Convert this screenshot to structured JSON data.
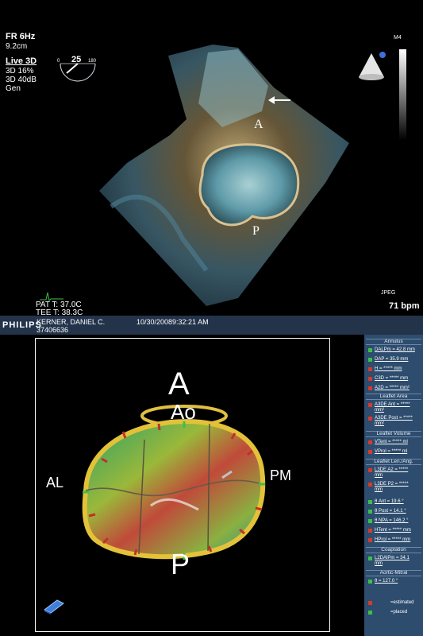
{
  "echo": {
    "frame_rate": "FR 6Hz",
    "depth": "9.2cm",
    "mode": "Live 3D",
    "param_1": "3D 16%",
    "param_2": "3D 40dB",
    "param_3": "Gen",
    "gauge_min": "0",
    "gauge_value": "25",
    "gauge_max": "180",
    "probe_label": "M4",
    "label_a": "A",
    "label_p": "P",
    "format": "JPEG",
    "heart_rate": "71 bpm",
    "pat_temp": "PAT T: 37.0C",
    "tee_temp": "TEE T: 38.3C"
  },
  "patient_bar": {
    "brand": "PHILIPS",
    "patient_name": "KERNER, DANIEL C.",
    "patient_id": "37406636",
    "datetime": "10/30/20089:32:21 AM"
  },
  "model": {
    "label_anterior": "A",
    "label_aortic": "Ao",
    "label_al": "AL",
    "label_pm": "PM",
    "label_posterior": "P"
  },
  "measurements": {
    "sections": [
      {
        "title": "Annulus",
        "rows": [
          {
            "text": "DALPm = 42.8 mm",
            "status": "green"
          },
          {
            "text": "DAP = 35.9 mm",
            "status": "green"
          },
          {
            "text": "H = ***** mm",
            "status": "red"
          },
          {
            "text": "C3D = ***** mm",
            "status": "red"
          },
          {
            "text": "A2D = ***** mm²",
            "status": "red"
          }
        ]
      },
      {
        "title": "Leaflet Area",
        "rows": [
          {
            "text": "A3DE Ant = *****",
            "text2": "mm²",
            "status": "red"
          },
          {
            "text": "A3DE Post = *****",
            "text2": "mm²",
            "status": "red"
          }
        ]
      },
      {
        "title": "Leaflet Volume",
        "rows": [
          {
            "text": "VTent = ***** ml",
            "status": "red"
          },
          {
            "text": "VProl = ***** ml",
            "status": "red"
          }
        ]
      },
      {
        "title": "Leaflet Len./Ang.",
        "rows": [
          {
            "text": "L3DE A2 = *****",
            "text2": "mm",
            "status": "red"
          },
          {
            "text": "L3DE P2 = *****",
            "text2": "mm",
            "status": "red"
          },
          {
            "text": "θ Ant = 19.6 °",
            "status": "green"
          },
          {
            "text": "θ Post = 14.1 °",
            "status": "green"
          },
          {
            "text": "θ NPA = 146.2 °",
            "status": "green"
          },
          {
            "text": "HTent = ***** mm",
            "status": "red"
          },
          {
            "text": "HProl = ***** mm",
            "status": "red"
          }
        ]
      },
      {
        "title": "Coaptation",
        "rows": [
          {
            "text": "L2DAlPm = 34.1",
            "text2": "mm",
            "status": "green"
          }
        ]
      },
      {
        "title": "Aortic-Mitral",
        "rows": [
          {
            "text": "θ = 127.0 °",
            "status": "green"
          }
        ]
      }
    ],
    "legend": [
      {
        "text": "=estimated",
        "status": "red"
      },
      {
        "text": "=placed",
        "status": "green"
      }
    ],
    "colors": {
      "green": "#3cbf4a",
      "red": "#d63a2c"
    }
  }
}
